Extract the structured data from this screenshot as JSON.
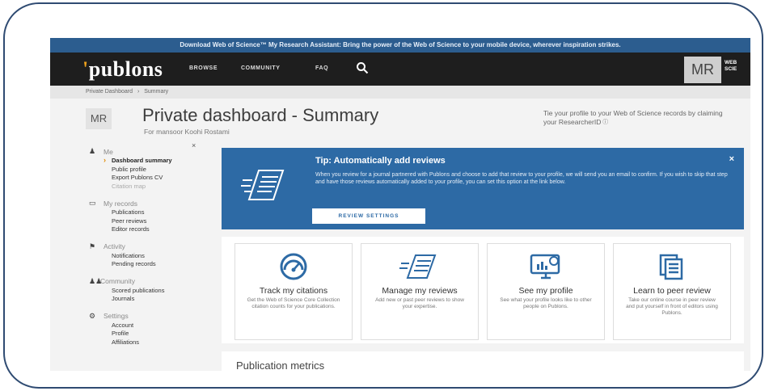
{
  "banner": {
    "text": "Download Web of Science™ My Research Assistant: Bring the power of the Web of Science to your mobile device, wherever inspiration strikes."
  },
  "navbar": {
    "logo": "publons",
    "items": [
      "BROWSE",
      "COMMUNITY",
      "FAQ"
    ],
    "avatar_initials": "MR",
    "wos_label_1": "WEB",
    "wos_label_2": "SCIE"
  },
  "breadcrumb": {
    "home": "Private Dashboard",
    "sep": "›",
    "current": "Summary"
  },
  "header": {
    "badge": "MR",
    "title": "Private dashboard - Summary",
    "subtitle": "For mansoor Koohi Rostami",
    "tie_text": "Tie your profile to your Web of Science records by claiming your ResearcherID"
  },
  "sidebar": {
    "close": "×",
    "sections": [
      {
        "title": "Me",
        "items": [
          "Dashboard summary",
          "Public profile",
          "Export Publons CV",
          "Citation map"
        ]
      },
      {
        "title": "My records",
        "items": [
          "Publications",
          "Peer reviews",
          "Editor records"
        ]
      },
      {
        "title": "Activity",
        "items": [
          "Notifications",
          "Pending records"
        ]
      },
      {
        "title": "Community",
        "items": [
          "Scored publications",
          "Journals"
        ]
      },
      {
        "title": "Settings",
        "items": [
          "Account",
          "Profile",
          "Affiliations"
        ]
      }
    ]
  },
  "tip": {
    "title": "Tip:  Automatically add reviews",
    "body": "When you review for a journal partnered with Publons and choose to add that review to your profile, we will send you an email to confirm. If you wish to skip that step and have those reviews automatically added to your profile, you can set this option at the link below.",
    "button": "REVIEW SETTINGS",
    "close": "×"
  },
  "cards": [
    {
      "title": "Track my citations",
      "desc": "Get the Web of Science Core Collection citation counts for your publications."
    },
    {
      "title": "Manage my reviews",
      "desc": "Add new or past peer reviews to show your expertise."
    },
    {
      "title": "See my profile",
      "desc": "See what your profile looks like to other people on Publons."
    },
    {
      "title": "Learn to peer review",
      "desc": "Take our online course in peer review and put yourself in front of editors using Publons."
    }
  ],
  "metrics": {
    "title": "Publication metrics"
  },
  "colors": {
    "tip_bg": "#2d6aa5",
    "navbar_bg": "#1e1e1e",
    "banner_bg": "#2c5d8f",
    "frame": "#2f4b72",
    "accent": "#e08a00"
  }
}
